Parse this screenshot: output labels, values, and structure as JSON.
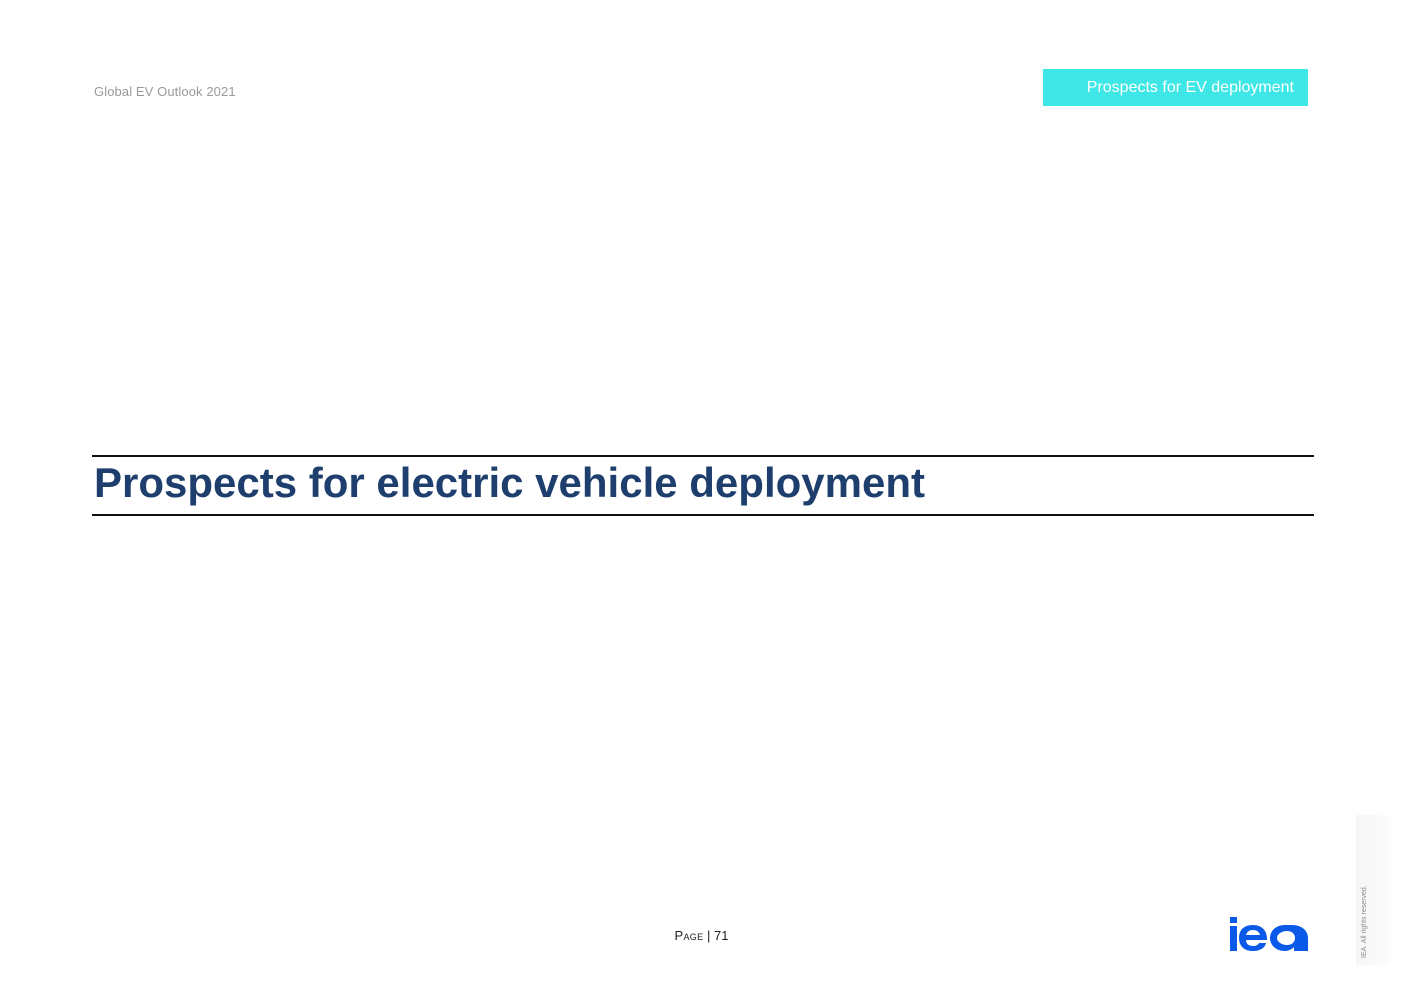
{
  "header": {
    "doc_title": "Global EV Outlook 2021",
    "section_tab": "Prospects for EV deployment",
    "section_tab_color": "#3fe6e6"
  },
  "main": {
    "heading": "Prospects for electric vehicle deployment",
    "heading_color": "#1e3f6d"
  },
  "footer": {
    "page_word": "Page",
    "page_separator": " | ",
    "page_number": "71",
    "logo_text": "iea",
    "logo_color": "#0a59e8",
    "rights": "IEA. All rights reserved."
  }
}
